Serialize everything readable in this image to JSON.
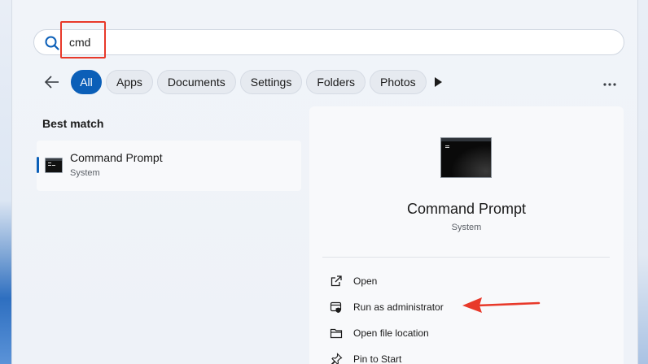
{
  "search": {
    "value": "cmd",
    "icon": "search-icon"
  },
  "filters": {
    "back_icon": "arrow-left-icon",
    "chips": [
      "All",
      "Apps",
      "Documents",
      "Settings",
      "Folders",
      "Photos"
    ],
    "active": "All",
    "more_icon": "more-horizontal-icon",
    "play_icon": "play-icon"
  },
  "best_match": {
    "heading": "Best match",
    "result": {
      "title": "Command Prompt",
      "subtitle": "System",
      "icon": "command-prompt-icon"
    }
  },
  "detail": {
    "title": "Command Prompt",
    "subtitle": "System",
    "actions": [
      {
        "label": "Open",
        "icon": "open-external-icon"
      },
      {
        "label": "Run as administrator",
        "icon": "shield-admin-icon"
      },
      {
        "label": "Open file location",
        "icon": "folder-icon"
      },
      {
        "label": "Pin to Start",
        "icon": "pin-icon"
      }
    ]
  },
  "colors": {
    "accent": "#0b5fb8",
    "annotation": "#e8392a"
  }
}
